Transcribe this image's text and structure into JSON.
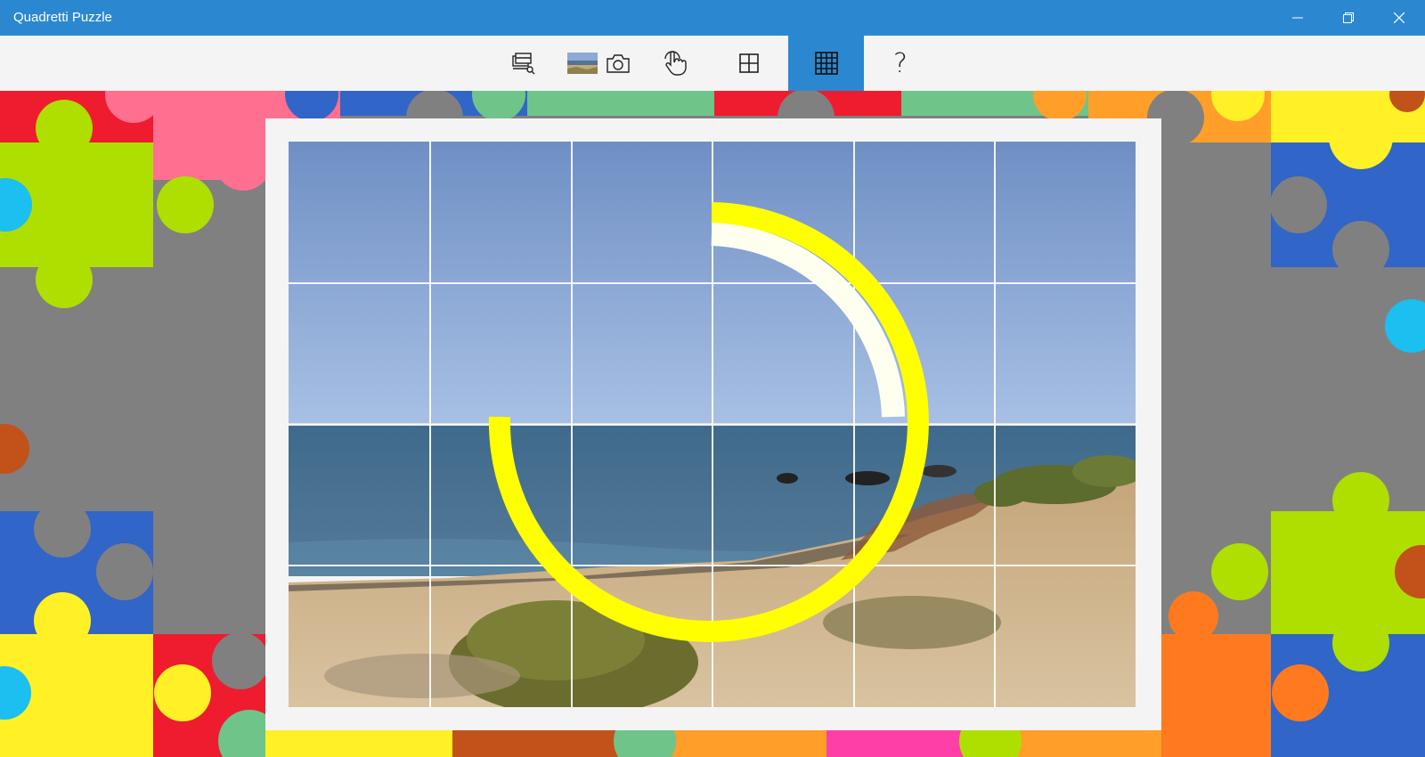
{
  "window": {
    "title": "Quadretti Puzzle",
    "controls": [
      "minimize-icon",
      "restore-icon",
      "close-icon"
    ]
  },
  "toolbar": {
    "buttons": [
      {
        "name": "select-image-button",
        "icon": "gallery-select-icon"
      },
      {
        "name": "image-thumbnail",
        "icon": "beach-thumbnail"
      },
      {
        "name": "camera-button",
        "icon": "camera-icon"
      },
      {
        "name": "touch-mode-button",
        "icon": "touch-hand-icon"
      },
      {
        "name": "grid-2x2-button",
        "icon": "grid-2x2-icon"
      },
      {
        "name": "grid-4x4-button",
        "icon": "grid-4x4-icon",
        "selected": true
      },
      {
        "name": "help-button",
        "icon": "question-mark-icon",
        "label": "?"
      }
    ]
  },
  "puzzle": {
    "columns": 6,
    "rows": 4,
    "image": "beach-seascape",
    "loading_ring_color": "#ffff00"
  },
  "colors": {
    "accent": "#2b88d0",
    "background": "#808080",
    "board": "#f4f4f4"
  }
}
